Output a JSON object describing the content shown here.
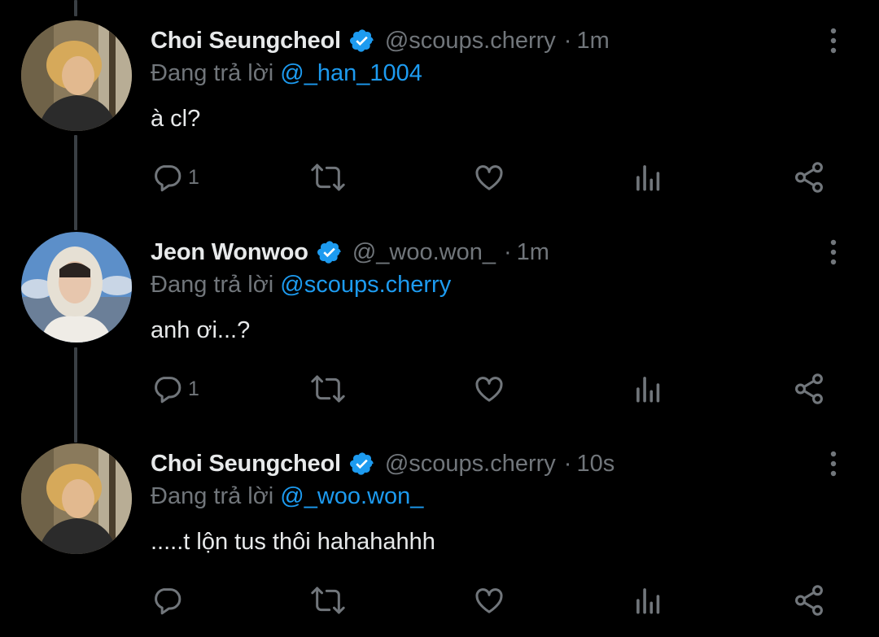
{
  "colors": {
    "background": "#000000",
    "primary_text": "#e7e9ea",
    "secondary_text": "#71767b",
    "accent": "#1d9bf0",
    "thread_line": "#3a3f44"
  },
  "tweets": [
    {
      "author_name": "Choi Seungcheol",
      "handle": "@scoups.cherry",
      "separator": "·",
      "time": "1m",
      "reply_prefix": "Đang trả lời",
      "reply_to": "@_han_1004",
      "text": "à cl?",
      "reply_count": "1",
      "icons": [
        "chat-bubble-icon",
        "retweet-icon",
        "heart-icon",
        "views-icon",
        "share-icon",
        "more-vertical-icon",
        "verified-badge-icon"
      ]
    },
    {
      "author_name": "Jeon Wonwoo",
      "handle": "@_woo.won_",
      "separator": "·",
      "time": "1m",
      "reply_prefix": "Đang trả lời",
      "reply_to": "@scoups.cherry",
      "text": "anh ơi...?",
      "reply_count": "1",
      "icons": [
        "chat-bubble-icon",
        "retweet-icon",
        "heart-icon",
        "views-icon",
        "share-icon",
        "more-vertical-icon",
        "verified-badge-icon"
      ]
    },
    {
      "author_name": "Choi Seungcheol",
      "handle": "@scoups.cherry",
      "separator": "·",
      "time": "10s",
      "reply_prefix": "Đang trả lời",
      "reply_to": "@_woo.won_",
      "text": ".....t lộn tus thôi hahahahhh",
      "reply_count": "",
      "icons": [
        "chat-bubble-icon",
        "retweet-icon",
        "heart-icon",
        "views-icon",
        "share-icon",
        "more-vertical-icon",
        "verified-badge-icon"
      ]
    }
  ]
}
